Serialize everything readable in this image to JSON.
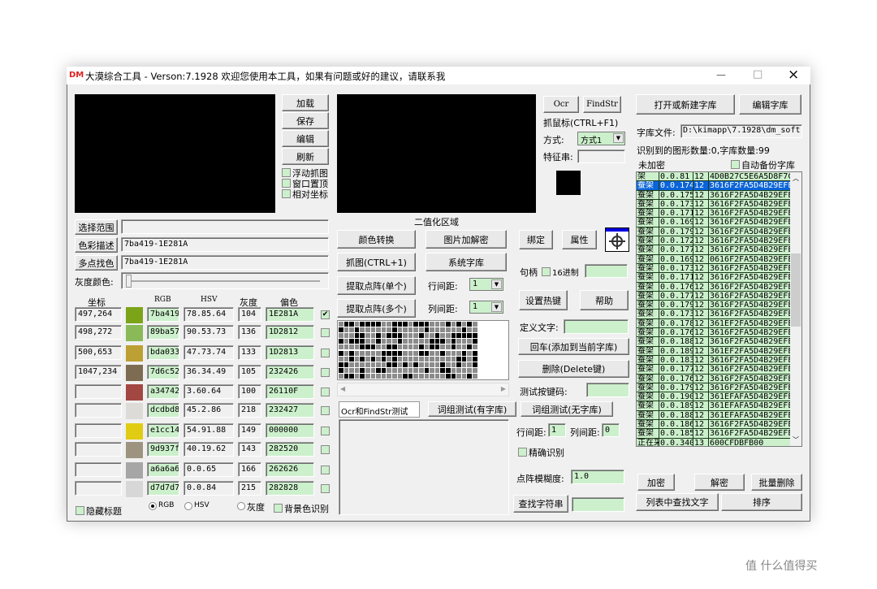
{
  "window": {
    "title": "大漠综合工具 -  Verson:7.1928  欢迎您使用本工具，如果有问题或好的建议，请联系我",
    "logo": "DM",
    "minimize": "—",
    "maximize": "□",
    "close": "×"
  },
  "left": {
    "buttons": {
      "load": "加载",
      "save": "保存",
      "edit": "编辑",
      "refresh": "刷新"
    },
    "checks": {
      "float_capture": "浮动抓图",
      "topmost": "窗口置顶",
      "relative_coord": "相对坐标"
    },
    "select_range": {
      "label": "选择范围",
      "value": ""
    },
    "color_desc": {
      "label": "色彩描述",
      "value": "7ba419-1E281A"
    },
    "multi_color": {
      "label": "多点找色",
      "value": "7ba419-1E281A"
    },
    "gray_color": {
      "label": "灰度颜色:",
      "slider_value": 0
    },
    "headers": {
      "coord": "坐标",
      "rgb": "RGB",
      "hsv": "HSV",
      "gray": "灰度",
      "offset": "偏色"
    },
    "rows": [
      {
        "coord": "497,264",
        "color": "#7ba419",
        "rgb": "7ba419",
        "hsv": "78.85.64",
        "gray": "104",
        "offset": "1E281A",
        "checked": true
      },
      {
        "coord": "498,272",
        "color": "#89ba57",
        "rgb": "89ba57",
        "hsv": "90.53.73",
        "gray": "136",
        "offset": "1D2812",
        "checked": false
      },
      {
        "coord": "500,653",
        "color": "#bda033",
        "rgb": "bda033",
        "hsv": "47.73.74",
        "gray": "133",
        "offset": "1D2813",
        "checked": false
      },
      {
        "coord": "1047,234",
        "color": "#7d6c52",
        "rgb": "7d6c52",
        "hsv": "36.34.49",
        "gray": "105",
        "offset": "232426",
        "checked": false
      },
      {
        "coord": "",
        "color": "#a34742",
        "rgb": "a34742",
        "hsv": "3.60.64",
        "gray": "100",
        "offset": "26110F",
        "checked": false
      },
      {
        "coord": "",
        "color": "#dcdbd8",
        "rgb": "dcdbd8",
        "hsv": "45.2.86",
        "gray": "218",
        "offset": "232427",
        "checked": false
      },
      {
        "coord": "",
        "color": "#e1cc14",
        "rgb": "e1cc14",
        "hsv": "54.91.88",
        "gray": "149",
        "offset": "000000",
        "checked": false
      },
      {
        "coord": "",
        "color": "#9d937f",
        "rgb": "9d937f",
        "hsv": "40.19.62",
        "gray": "143",
        "offset": "282520",
        "checked": false
      },
      {
        "coord": "",
        "color": "#a6a6a6",
        "rgb": "a6a6a6",
        "hsv": "0.0.65",
        "gray": "166",
        "offset": "262626",
        "checked": false
      },
      {
        "coord": "",
        "color": "#d7d7d7",
        "rgb": "d7d7d7",
        "hsv": "0.0.84",
        "gray": "215",
        "offset": "282828",
        "checked": false
      }
    ],
    "hide_title": "隐藏标题",
    "modes": {
      "rgb": "RGB",
      "hsv": "HSV",
      "gray": "灰度",
      "selected": "RGB"
    },
    "bg_color_recog": "背景色识别"
  },
  "middle": {
    "binarize_label": "二值化区域",
    "buttons": {
      "color_convert": "颜色转换",
      "image_crypt": "图片加解密",
      "capture": "抓图(CTRL+1)",
      "system_lib": "系统字库",
      "extract_single": "提取点阵(单个)",
      "extract_multi": "提取点阵(多个)"
    },
    "row_spacing": {
      "label": "行间距:",
      "value": "1"
    },
    "col_spacing": {
      "label": "列间距:",
      "value": "1"
    },
    "tabs": [
      "Ocr和FindStr测试",
      "词组测试(有字库)",
      "词组测试(无字库)"
    ],
    "test_text": ""
  },
  "tools": {
    "ocr": "Ocr",
    "findstr": "FindStr",
    "grab_mouse": "抓鼠标(CTRL+F1)",
    "mode_label": "方式:",
    "mode_value": "方式1",
    "feature_label": "特征串:",
    "feature_value": "",
    "bind": "绑定",
    "props": "属性",
    "handle_label": "句柄",
    "hex16": "16进制",
    "handle_value": "",
    "set_hotkey": "设置热键",
    "help": "帮助",
    "define_text_label": "定义文字:",
    "define_text_value": "",
    "enter_add": "回车(添加到当前字库)",
    "delete": "删除(Delete键)",
    "test_key_label": "测试按键码:",
    "test_key_value": "",
    "row_gap_label": "行间距:",
    "row_gap_value": "1",
    "col_gap_label": "列间距:",
    "col_gap_value": "0",
    "exact": "精确识别",
    "fuzzy_label": "点阵模糊度:",
    "fuzzy_value": "1.0",
    "find_string": "查找字符串",
    "find_value": ""
  },
  "library": {
    "open_new": "打开或新建字库",
    "edit": "编辑字库",
    "file_label": "字库文件:",
    "file_value": "D:\\kimapp\\7.1928\\dm_soft.t",
    "count_text": "识别到的图形数量:0,字库数量:99",
    "encrypt_status": "未加密",
    "auto_backup": "自动备份字库",
    "items": [
      [
        "架",
        "0.0.81",
        "12",
        "4D0B27C5E6A5D8F7C0FE"
      ],
      [
        "蚕架",
        "0.0.174",
        "12",
        "3616F2FA5D4B29EFE"
      ],
      [
        "蚕架",
        "0.0.175",
        "12",
        "3616F2FA5D4B29EFE"
      ],
      [
        "蚕架",
        "0.0.173",
        "12",
        "3616F2FA5D4B29EFE"
      ],
      [
        "蚕架",
        "0.0.171",
        "12",
        "3616F2FA5D4B29EFE"
      ],
      [
        "蚕架",
        "0.0.169",
        "12",
        "3616F2FA5D4B29EFE"
      ],
      [
        "蚕架",
        "0.0.179",
        "12",
        "3616F2FA5D4B29EFE"
      ],
      [
        "蚕架",
        "0.0.172",
        "12",
        "3616F2FA5D4B29EFE"
      ],
      [
        "蚕架",
        "0.0.177",
        "12",
        "3616F2FA5D4B29EFE"
      ],
      [
        "蚕架",
        "0.0.169",
        "12",
        "0616F2FA5D4B29EFE"
      ],
      [
        "蚕架",
        "0.0.173",
        "12",
        "3616F2FA5D4B29EFE"
      ],
      [
        "蚕架",
        "0.0.171",
        "12",
        "3616F2FA5D4B29EFE"
      ],
      [
        "蚕架",
        "0.0.176",
        "12",
        "3616F2FA5D4B29EFE"
      ],
      [
        "蚕架",
        "0.0.177",
        "12",
        "3616F2FA5D4B29EFE"
      ],
      [
        "蚕架",
        "0.0.179",
        "12",
        "3616F2FA5D4B29EFE"
      ],
      [
        "蚕架",
        "0.0.173",
        "12",
        "3616F2FA5D4B29EFE"
      ],
      [
        "蚕架",
        "0.0.178",
        "12",
        "361EF2FA5D4B29EFE"
      ],
      [
        "蚕架",
        "0.0.176",
        "12",
        "3616F2FA5D4B29EFE"
      ],
      [
        "蚕架",
        "0.0.188",
        "12",
        "3616F2FA5D4B29EFE"
      ],
      [
        "蚕架",
        "0.0.189",
        "12",
        "361EF2FA5D4B29EFE"
      ],
      [
        "蚕架",
        "0.0.183",
        "12",
        "3616F2FA5D4B29EFE"
      ],
      [
        "蚕架",
        "0.0.177",
        "12",
        "3616F2FA5D4B29EFE"
      ],
      [
        "蚕架",
        "0.0.176",
        "12",
        "3616F2FA5D4B29EFE"
      ],
      [
        "蚕架",
        "0.0.179",
        "12",
        "3616F2FA5D4B29EFE"
      ],
      [
        "蚕架",
        "0.0.190",
        "12",
        "361EFAFA5D4B29EFE"
      ],
      [
        "蚕架",
        "0.0.189",
        "12",
        "361EFAFA5D4B29EFE"
      ],
      [
        "蚕架",
        "0.0.188",
        "12",
        "361EFAFA5D4B29EFE"
      ],
      [
        "蚕架",
        "0.0.186",
        "12",
        "3616F2FA5D4B29EFE"
      ],
      [
        "蚕架",
        "0.0.185",
        "12",
        "3616F2FA5D4B29EFE"
      ],
      [
        "正在采集",
        "0.0.340",
        "13",
        "600CFDBFB00"
      ]
    ],
    "selected_index": 1,
    "encrypt": "加密",
    "decrypt": "解密",
    "batch_delete": "批量删除",
    "find_in_list": "列表中查找文字",
    "sort": "排序"
  },
  "watermark": "值 什么值得买"
}
